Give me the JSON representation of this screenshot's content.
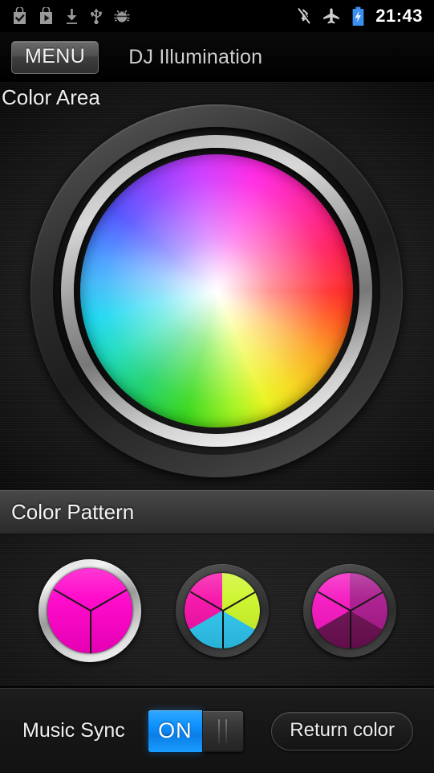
{
  "status_bar": {
    "time": "21:43",
    "left_icons": [
      {
        "name": "market-bag-check-icon",
        "label": "App installed"
      },
      {
        "name": "market-bag-play-icon",
        "label": "Play Store"
      },
      {
        "name": "download-icon",
        "label": "Download"
      },
      {
        "name": "usb-icon",
        "label": "USB connected"
      },
      {
        "name": "android-debug-bug-icon",
        "label": "USB debugging"
      }
    ],
    "right_icons": [
      {
        "name": "bluetooth-off-icon",
        "label": "Bluetooth disabled"
      },
      {
        "name": "airplane-mode-icon",
        "label": "Airplane mode"
      },
      {
        "name": "battery-charging-icon",
        "label": "Battery charging",
        "color": "#3d8fef"
      }
    ]
  },
  "title_bar": {
    "menu_label": "MENU",
    "app_title": "DJ Illumination"
  },
  "color_area": {
    "section_label": "Color Area",
    "wheel": {
      "name": "color-wheel",
      "type": "hsv-conic-wheel",
      "center_color": "#ffffff",
      "hue_stops": [
        "#ff0000",
        "#ffdd00",
        "#9dff00",
        "#22e000",
        "#00dcb4",
        "#00d2f0",
        "#3a3aff",
        "#7a20ff",
        "#ff00e0",
        "#ff0090"
      ]
    },
    "screws": [
      "screw-bottom-left",
      "screw-bottom-right"
    ]
  },
  "color_pattern": {
    "section_label": "Color Pattern",
    "swatches": [
      {
        "name": "pattern-1",
        "selected": true,
        "colors": [
          "#ff00c8",
          "#ff00c8",
          "#ff00c8"
        ]
      },
      {
        "name": "pattern-2",
        "selected": false,
        "colors": [
          "#ccf527",
          "#2ec6f0",
          "#f50fa8"
        ]
      },
      {
        "name": "pattern-3",
        "selected": false,
        "colors": [
          "#a8188c",
          "#6b0f52",
          "#f515c0"
        ]
      }
    ]
  },
  "bottom_bar": {
    "music_sync_label": "Music Sync",
    "toggle": {
      "name": "music-sync-toggle",
      "state": "ON",
      "on_label": "ON",
      "accent_color": "#0e90ff"
    },
    "return_button_label": "Return color"
  }
}
